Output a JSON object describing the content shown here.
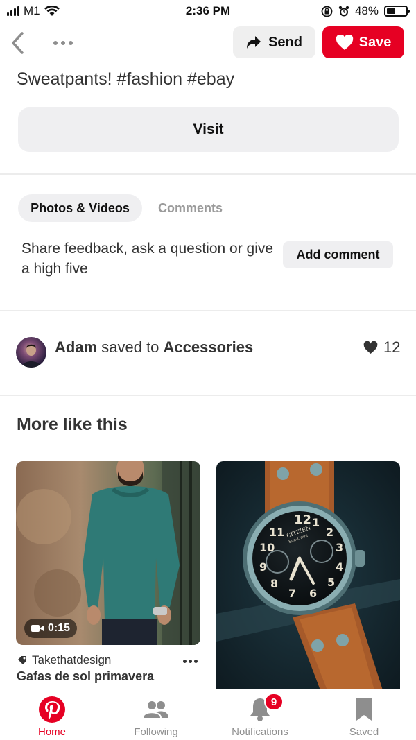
{
  "status_bar": {
    "carrier": "M1",
    "time": "2:36 PM",
    "battery": "48%",
    "battery_level": 0.48
  },
  "header": {
    "back_icon": "chevron-left-icon",
    "more_icon": "ellipsis-icon",
    "send_label": "Send",
    "save_label": "Save"
  },
  "pin": {
    "description": "Sweatpants! #fashion #ebay",
    "visit_label": "Visit"
  },
  "feedback": {
    "tabs": [
      {
        "label": "Photos & Videos",
        "active": true
      },
      {
        "label": "Comments",
        "active": false
      }
    ],
    "prompt": "Share feedback, ask a question or give a high five",
    "add_comment_label": "Add comment"
  },
  "saved_by": {
    "user": "Adam",
    "action": "saved to",
    "board": "Accessories",
    "like_count": "12"
  },
  "more_like_this": {
    "heading": "More like this",
    "pins": [
      {
        "image": "man-green-sweater-photo",
        "video_duration": "0:15",
        "source": "Takethatdesign",
        "title": "Gafas de sol primavera"
      },
      {
        "image": "citizen-watch-photo",
        "dial_brand": "CITIZEN",
        "dial_sub": "Eco-Drive"
      }
    ]
  },
  "tab_bar": {
    "items": [
      {
        "label": "Home",
        "icon": "pinterest-logo-icon",
        "active": true
      },
      {
        "label": "Following",
        "icon": "people-icon",
        "active": false
      },
      {
        "label": "Notifications",
        "icon": "bell-icon",
        "active": false,
        "badge": "9"
      },
      {
        "label": "Saved",
        "icon": "bookmark-icon",
        "active": false
      }
    ]
  },
  "colors": {
    "brand_red": "#e60023",
    "button_gray": "#efeff1",
    "text": "#333333",
    "muted": "#8e8e8e"
  }
}
